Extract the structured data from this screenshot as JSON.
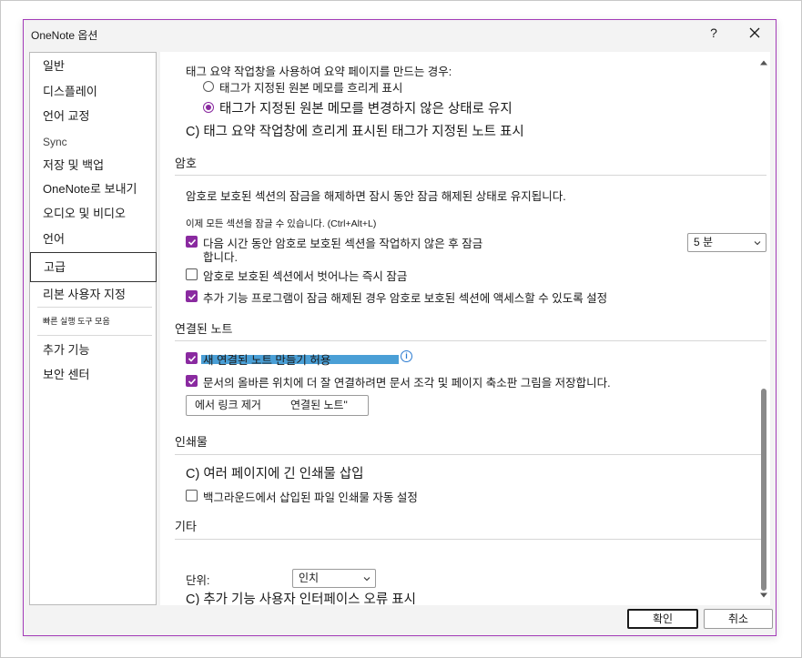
{
  "dialog": {
    "title": "OneNote 옵션",
    "help": "?",
    "ok_label": "확인",
    "cancel_label": "취소"
  },
  "sidebar": {
    "items": [
      {
        "label": "일반"
      },
      {
        "label": "디스플레이"
      },
      {
        "label": "언어 교정"
      },
      {
        "label": "Sync"
      },
      {
        "label": "저장 및 백업"
      },
      {
        "label": "OneNote로 보내기"
      },
      {
        "label": "오디오 및 비디오"
      },
      {
        "label": "언어"
      },
      {
        "label": "고급",
        "selected": true
      },
      {
        "label": "리본 사용자 지정"
      },
      {
        "label": "빠른 실행 도구 모음"
      },
      {
        "label": "추가 기능"
      },
      {
        "label": "보안 센터"
      }
    ]
  },
  "tag_summary": {
    "intro": "태그 요약 작업창을 사용하여 요약 페이지를 만드는 경우:",
    "option1": "태그가 지정된 원본 메모를 흐리게 표시",
    "option2": "태그가 지정된 원본 메모를 변경하지 않은 상태로 유지",
    "option3": "C) 태그 요약 작업창에 흐리게 표시된 태그가 지정된 노트 표시"
  },
  "password": {
    "header": "암호",
    "desc": "암호로 보호된 섹션의 잠금을 해제하면 잠시 동안 잠금 해제된 상태로 유지됩니다.",
    "lock_all": "이제 모든 섹션을 잠글 수 있습니다. (Ctrl+Alt+L)",
    "lock_after_line1": "다음 시간 동안 암호로 보호된 섹션을 작업하지 않은 후 잠금",
    "lock_after_line2": "합니다.",
    "lock_after_value": "5 분",
    "lock_on_leave": "암호로 보호된 섹션에서 벗어나는 즉시 잠금",
    "allow_addins": "추가 기능 프로그램이 잠금 해제된 경우 암호로 보호된 섹션에 액세스할 수 있도록 설정"
  },
  "linked_notes": {
    "header": "연결된 노트",
    "allow_new": "새 연결된 노트 만들기 허용",
    "info": "i",
    "save_snippets": "문서의 올바른 위치에 더 잘 연결하려면 문서 조각 및 페이지 축소판 그림을 저장합니다.",
    "remove_links_part1": "에서 링크 제거",
    "remove_links_part2": "연결된 노트\""
  },
  "printouts": {
    "header": "인쇄물",
    "insert_long": "C) 여러 페이지에 긴 인쇄물 삽입",
    "background": "백그라운드에서 삽입된 파일 인쇄물 자동 설정"
  },
  "other": {
    "header": "기타",
    "units_label": "단위:",
    "units_value": "인치",
    "addin_errors": "C) 추가 기능 사용자 인터페이스 오류 표시"
  },
  "colors": {
    "accent": "#8a2aa0",
    "dialog_border": "#a33bb8",
    "selection_highlight": "#4a9fd6"
  }
}
